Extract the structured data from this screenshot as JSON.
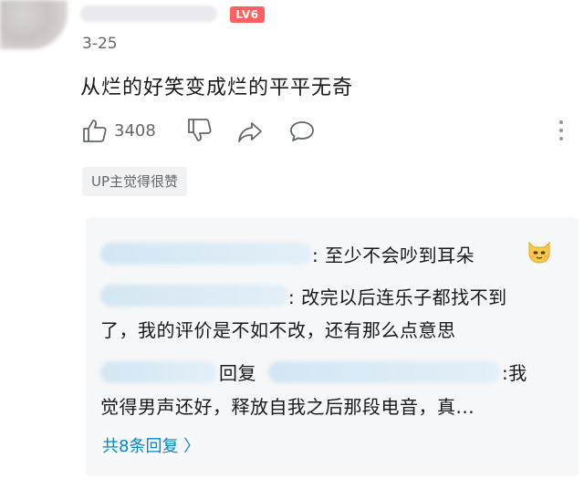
{
  "comment": {
    "level_badge": "LV6",
    "date": "3-25",
    "text": "从烂的好笑变成烂的平平无奇",
    "like_count": "3408",
    "up_liked_label": "UP主觉得很赞"
  },
  "replies": {
    "reply1_text": ": 至少不会吵到耳朵",
    "reply2_text_line1": ": 改完以后连乐子都找不到",
    "reply2_text_line2": "了，我的评价是不如不改，还有那么点意思",
    "reply3_reply_word": "回复",
    "reply3_text_line1": ":我",
    "reply3_text_line2": "觉得男声还好，释放自我之后那段电音，真...",
    "view_all_label": "共8条回复 〉"
  },
  "icons": {
    "like": "thumbs-up-icon",
    "dislike": "thumbs-down-icon",
    "share": "share-icon",
    "reply": "reply-bubble-icon",
    "more": "more-vertical-icon",
    "emoji": "cat-emoji-icon"
  },
  "colors": {
    "level_badge_bg": "#ff5f5f",
    "link": "#008ac5",
    "secondary_text": "#61666d"
  }
}
